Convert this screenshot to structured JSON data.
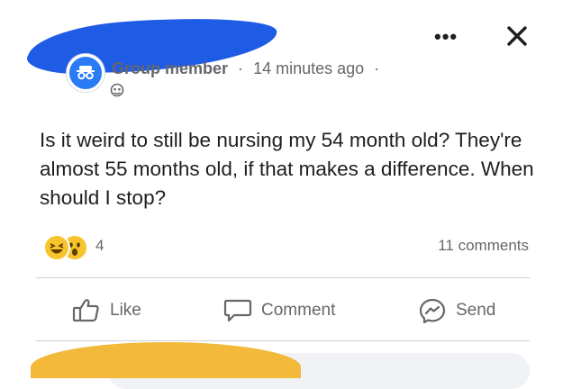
{
  "header": {
    "author_role": "Group member",
    "separator": "·",
    "timestamp": "14 minutes ago",
    "trailing_separator": "·",
    "more_label": "•••",
    "close_icon": "close-icon",
    "privacy_icon": "group-privacy-icon"
  },
  "post": {
    "text": "Is it weird to still be nursing my 54 month old? They're almost 55 months old, if that makes a difference. When should I stop?"
  },
  "engagement": {
    "reaction_emojis": [
      "haha-emoji",
      "wow-emoji"
    ],
    "reaction_count": "4",
    "comment_count": "11 comments"
  },
  "actions": {
    "like_label": "Like",
    "comment_label": "Comment",
    "send_label": "Send"
  },
  "colors": {
    "brand_blue": "#2a7bf6",
    "redaction_blue": "#1f5ce6",
    "redaction_yellow": "#f2b93b",
    "meta_gray": "#65676b",
    "text": "#1c1e21"
  }
}
